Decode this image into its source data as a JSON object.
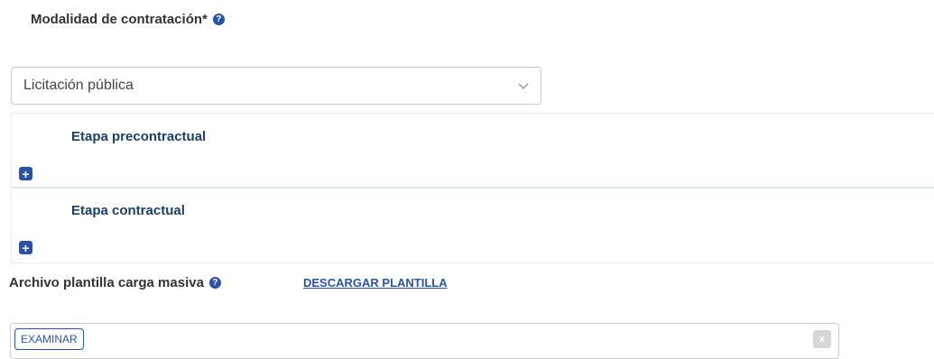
{
  "modality": {
    "label": "Modalidad de contratación*",
    "help_icon": "question-circle-icon",
    "help_glyph": "?",
    "selected": "Licitación pública",
    "chevron_icon": "chevron-down-icon"
  },
  "stages": [
    {
      "title": "Etapa precontractual",
      "add_icon": "plus-icon",
      "add_glyph": "+"
    },
    {
      "title": "Etapa contractual",
      "add_icon": "plus-icon",
      "add_glyph": "+"
    }
  ],
  "bulk_upload": {
    "label": "Archivo plantilla carga masiva",
    "help_glyph": "?",
    "download_link": "DESCARGAR PLANTILLA",
    "browse_button": "EXAMINAR",
    "clear_button": "x"
  },
  "colors": {
    "accent": "#2a53a5",
    "stage_title": "#1c3f66",
    "border": "#c8c8c8"
  }
}
